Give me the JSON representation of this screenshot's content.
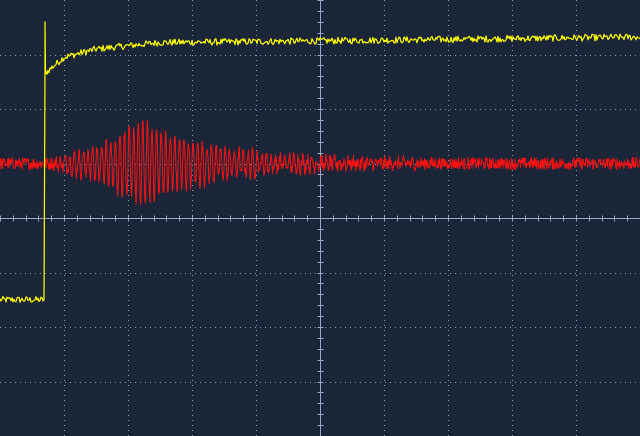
{
  "screen": {
    "background": "#1b2538",
    "grid_color": "#9aa8c8",
    "grid": true
  },
  "chart_data": {
    "type": "line",
    "grid": true,
    "x_divisions": 10,
    "y_divisions": 8,
    "xlim": [
      -5,
      5
    ],
    "ylim": [
      -4,
      4
    ],
    "series": [
      {
        "color": "#ffff00",
        "trigger_x": -4.3,
        "level_before": -1.5,
        "spike_peak": 3.6,
        "settle_points": [
          [
            -4.3,
            2.65
          ],
          [
            -4.0,
            2.95
          ],
          [
            -3.5,
            3.1
          ],
          [
            -2.5,
            3.22
          ],
          [
            0.0,
            3.25
          ],
          [
            5.0,
            3.32
          ]
        ],
        "noise_pp": 0.12
      },
      {
        "color": "#ff1010",
        "baseline": 1.0,
        "burst_start_x": -4.3,
        "burst_peak_x": -2.8,
        "burst_peak_amplitude": 0.75,
        "ring_frequency_per_div": 14,
        "steady_noise_pp": 0.22
      }
    ]
  }
}
